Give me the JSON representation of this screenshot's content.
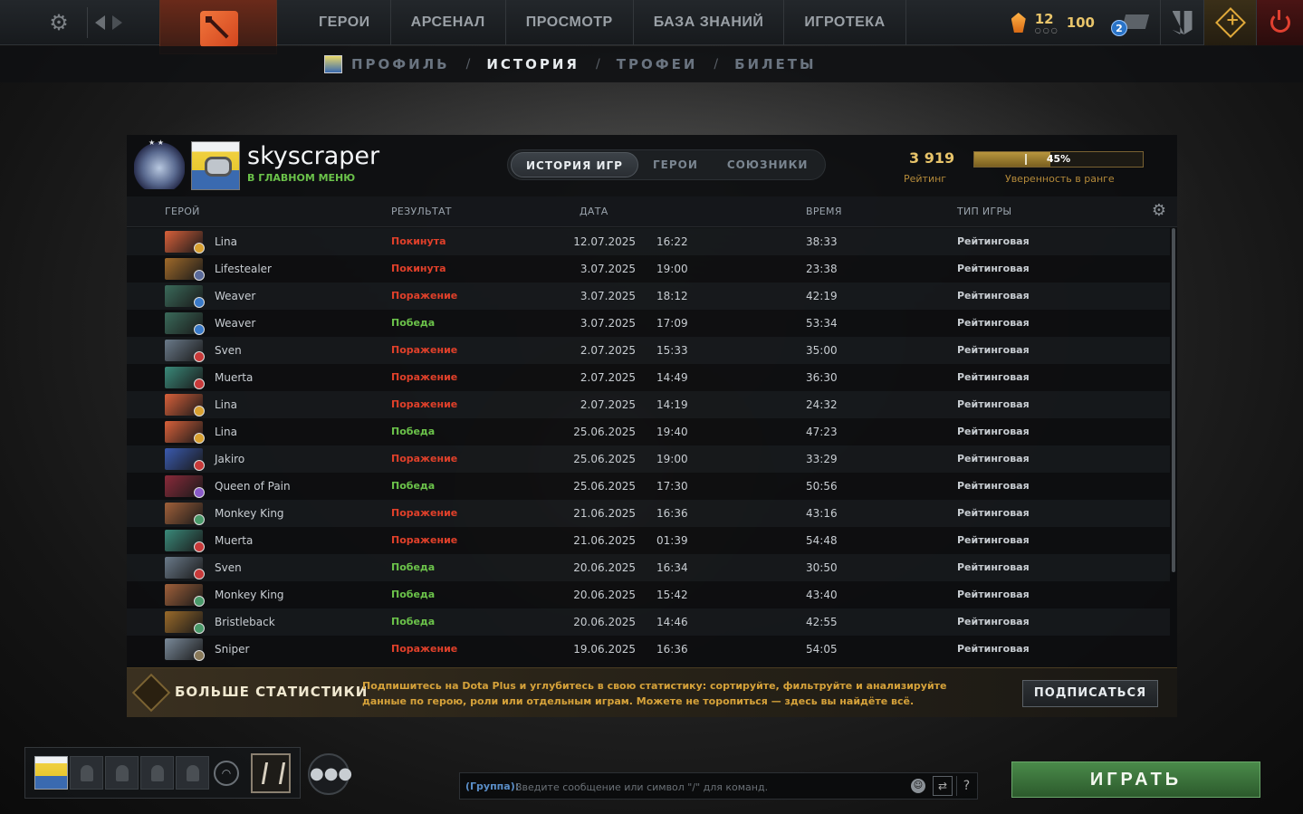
{
  "topnav": {
    "items": [
      "ГЕРОИ",
      "АРСЕНАЛ",
      "ПРОСМОТР",
      "БАЗА ЗНАНИЙ",
      "ИГРОТЕКА"
    ],
    "level": "12",
    "level_pips": "○○○",
    "currency": "100",
    "inbox_count": "2"
  },
  "subnav": {
    "items": [
      "ПРОФИЛЬ",
      "ИСТОРИЯ",
      "ТРОФЕИ",
      "БИЛЕТЫ"
    ],
    "active": "ИСТОРИЯ",
    "separator": "/"
  },
  "profile": {
    "username": "skyscraper",
    "status": "В ГЛАВНОМ МЕНЮ",
    "tabs": [
      "ИСТОРИЯ ИГР",
      "ГЕРОИ",
      "СОЮЗНИКИ"
    ],
    "active_tab": "ИСТОРИЯ ИГР",
    "rating_value": "3 919",
    "rating_label": "Рейтинг",
    "confidence_value": 45,
    "confidence_text": "45%",
    "confidence_label": "Уверенность в ранге"
  },
  "columns": {
    "hero": "ГЕРОЙ",
    "result": "РЕЗУЛЬТАТ",
    "date": "ДАТА",
    "time": "ВРЕМЯ",
    "type": "ТИП ИГРЫ"
  },
  "matches": [
    {
      "hero": "Lina",
      "result": "Покинута",
      "outcome": "loss",
      "date": "12.07.2025",
      "time": "16:22",
      "duration": "38:33",
      "type": "Рейтинговая",
      "color": "#d8603a",
      "badge": "#d8a030"
    },
    {
      "hero": "Lifestealer",
      "result": "Покинута",
      "outcome": "loss",
      "date": "3.07.2025",
      "time": "19:00",
      "duration": "23:38",
      "type": "Рейтинговая",
      "color": "#a06a2a",
      "badge": "#5a6a9a"
    },
    {
      "hero": "Weaver",
      "result": "Поражение",
      "outcome": "loss",
      "date": "3.07.2025",
      "time": "18:12",
      "duration": "42:19",
      "type": "Рейтинговая",
      "color": "#3a6a5a",
      "badge": "#3a7ac8"
    },
    {
      "hero": "Weaver",
      "result": "Победа",
      "outcome": "win",
      "date": "3.07.2025",
      "time": "17:09",
      "duration": "53:34",
      "type": "Рейтинговая",
      "color": "#3a6a5a",
      "badge": "#3a7ac8"
    },
    {
      "hero": "Sven",
      "result": "Поражение",
      "outcome": "loss",
      "date": "2.07.2025",
      "time": "15:33",
      "duration": "35:00",
      "type": "Рейтинговая",
      "color": "#6a7a8a",
      "badge": "#c83a3a"
    },
    {
      "hero": "Muerta",
      "result": "Поражение",
      "outcome": "loss",
      "date": "2.07.2025",
      "time": "14:49",
      "duration": "36:30",
      "type": "Рейтинговая",
      "color": "#3a8a7a",
      "badge": "#c83a3a"
    },
    {
      "hero": "Lina",
      "result": "Поражение",
      "outcome": "loss",
      "date": "2.07.2025",
      "time": "14:19",
      "duration": "24:32",
      "type": "Рейтинговая",
      "color": "#d8603a",
      "badge": "#d8a030"
    },
    {
      "hero": "Lina",
      "result": "Победа",
      "outcome": "win",
      "date": "25.06.2025",
      "time": "19:40",
      "duration": "47:23",
      "type": "Рейтинговая",
      "color": "#d8603a",
      "badge": "#d8a030"
    },
    {
      "hero": "Jakiro",
      "result": "Поражение",
      "outcome": "loss",
      "date": "25.06.2025",
      "time": "19:00",
      "duration": "33:29",
      "type": "Рейтинговая",
      "color": "#3a5ab0",
      "badge": "#c83a3a"
    },
    {
      "hero": "Queen of Pain",
      "result": "Победа",
      "outcome": "win",
      "date": "25.06.2025",
      "time": "17:30",
      "duration": "50:56",
      "type": "Рейтинговая",
      "color": "#8a2a3a",
      "badge": "#8a5ac8"
    },
    {
      "hero": "Monkey King",
      "result": "Поражение",
      "outcome": "loss",
      "date": "21.06.2025",
      "time": "16:36",
      "duration": "43:16",
      "type": "Рейтинговая",
      "color": "#a0603a",
      "badge": "#4a9a6a"
    },
    {
      "hero": "Muerta",
      "result": "Поражение",
      "outcome": "loss",
      "date": "21.06.2025",
      "time": "01:39",
      "duration": "54:48",
      "type": "Рейтинговая",
      "color": "#3a8a7a",
      "badge": "#c83a3a"
    },
    {
      "hero": "Sven",
      "result": "Победа",
      "outcome": "win",
      "date": "20.06.2025",
      "time": "16:34",
      "duration": "30:50",
      "type": "Рейтинговая",
      "color": "#6a7a8a",
      "badge": "#c83a3a"
    },
    {
      "hero": "Monkey King",
      "result": "Победа",
      "outcome": "win",
      "date": "20.06.2025",
      "time": "15:42",
      "duration": "43:40",
      "type": "Рейтинговая",
      "color": "#a0603a",
      "badge": "#4a9a6a"
    },
    {
      "hero": "Bristleback",
      "result": "Победа",
      "outcome": "win",
      "date": "20.06.2025",
      "time": "14:46",
      "duration": "42:55",
      "type": "Рейтинговая",
      "color": "#9a6a2a",
      "badge": "#4a9a6a"
    },
    {
      "hero": "Sniper",
      "result": "Поражение",
      "outcome": "loss",
      "date": "19.06.2025",
      "time": "16:36",
      "duration": "54:05",
      "type": "Рейтинговая",
      "color": "#7a8a9a",
      "badge": "#8a7a5a"
    }
  ],
  "plus_banner": {
    "title": "БОЛЬШЕ СТАТИСТИКИ",
    "description": "Подпишитесь на Dota Plus и углубитесь в свою статистику: сортируйте, фильтруйте и анализируйте данные по герою, роли или отдельным играм. Можете не торопиться — здесь вы найдёте всё.",
    "button": "ПОДПИСАТЬСЯ"
  },
  "chat": {
    "label": "(Группа):",
    "placeholder": "Введите сообщение или символ \"/\" для команд.",
    "help": "?"
  },
  "play_button": "ИГРАТЬ",
  "colors": {
    "win": "#6bc24a",
    "loss": "#e0402a",
    "gold": "#e8c46a"
  }
}
